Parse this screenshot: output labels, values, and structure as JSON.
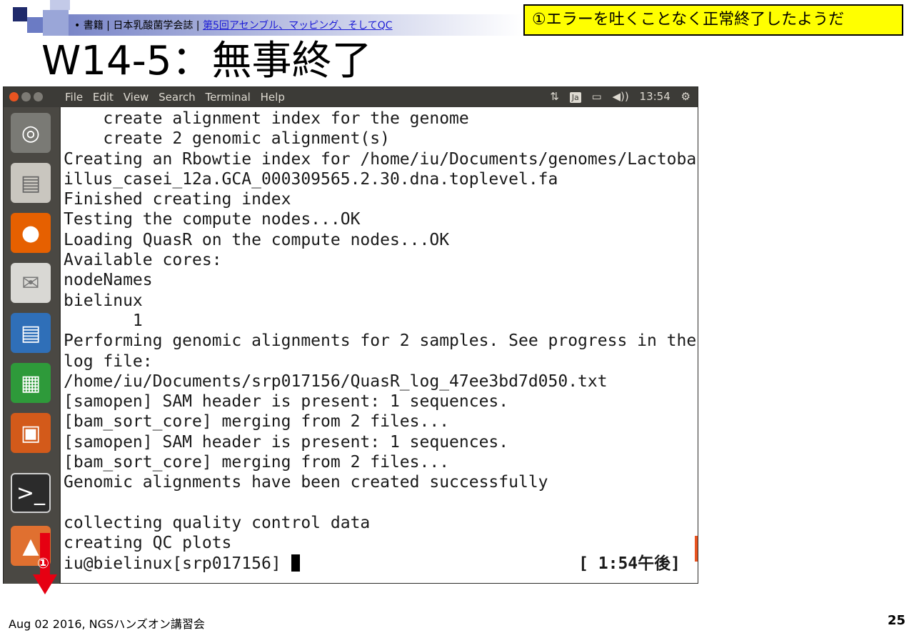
{
  "header": {
    "breadcrumb_prefix": "• 書籍 | 日本乳酸菌学会誌 | ",
    "breadcrumb_link": "第5回アセンブル、マッピング、そしてQC",
    "callout": "①エラーを吐くことなく正常終了したようだ",
    "title": "W14-5：無事終了"
  },
  "window": {
    "menus": [
      "File",
      "Edit",
      "View",
      "Search",
      "Terminal",
      "Help"
    ],
    "indicators": {
      "network": "⇅",
      "lang": "Ja",
      "battery": "▭",
      "volume": "◀))",
      "clock": "13:54",
      "settings": "⚙"
    }
  },
  "launcher": {
    "items": [
      "ubuntu-dash",
      "files",
      "firefox",
      "mail",
      "writer",
      "calc",
      "impress",
      "terminal",
      "software-updater"
    ]
  },
  "terminal": {
    "lines": [
      "    create alignment index for the genome",
      "    create 2 genomic alignment(s)",
      "Creating an Rbowtie index for /home/iu/Documents/genomes/Lactobac",
      "illus_casei_12a.GCA_000309565.2.30.dna.toplevel.fa",
      "Finished creating index",
      "Testing the compute nodes...OK",
      "Loading QuasR on the compute nodes...OK",
      "Available cores:",
      "nodeNames",
      "bielinux",
      "       1",
      "Performing genomic alignments for 2 samples. See progress in the",
      "log file:",
      "/home/iu/Documents/srp017156/QuasR_log_47ee3bd7d050.txt",
      "[samopen] SAM header is present: 1 sequences.",
      "[bam_sort_core] merging from 2 files...",
      "[samopen] SAM header is present: 1 sequences.",
      "[bam_sort_core] merging from 2 files...",
      "Genomic alignments have been created successfully",
      "",
      "collecting quality control data",
      "creating QC plots"
    ],
    "prompt": "iu@bielinux[srp017156] ",
    "prompt_time": "[ 1:54午後]"
  },
  "marker": {
    "label": "①"
  },
  "footer": {
    "text": "Aug 02 2016, NGSハンズオン講習会",
    "page": "25"
  }
}
